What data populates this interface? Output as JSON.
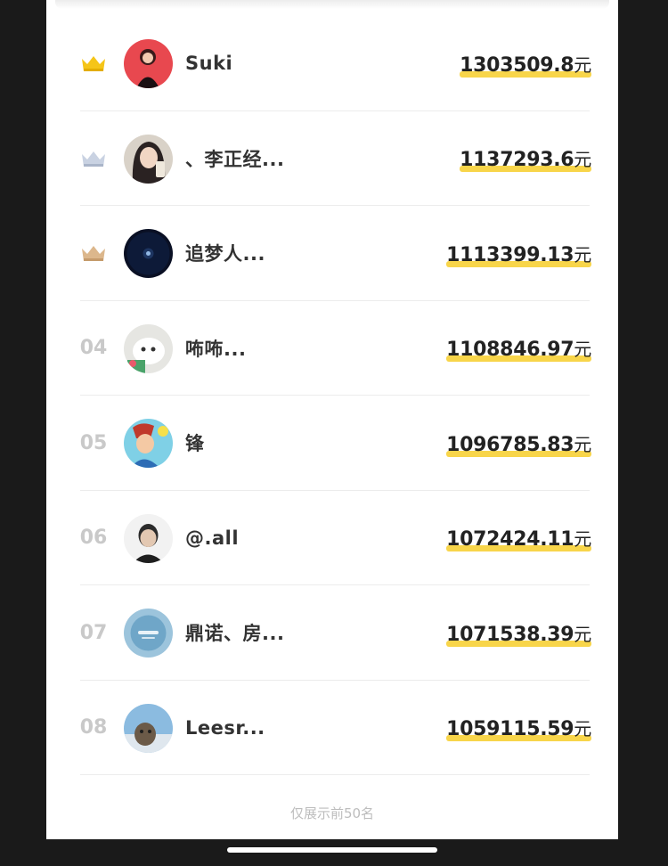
{
  "leaderboard": {
    "rows": [
      {
        "rank": "",
        "medal": "gold",
        "name": "Suki",
        "amount": "1303509.8",
        "unit": "元",
        "avatar": "avatar-red-dress"
      },
      {
        "rank": "",
        "medal": "silver",
        "name": "、李正经...",
        "amount": "1137293.6",
        "unit": "元",
        "avatar": "avatar-woman-selfie"
      },
      {
        "rank": "",
        "medal": "bronze",
        "name": "追梦人...",
        "amount": "1113399.13",
        "unit": "元",
        "avatar": "avatar-night-sky"
      },
      {
        "rank": "04",
        "medal": "",
        "name": "咘咘...",
        "amount": "1108846.97",
        "unit": "元",
        "avatar": "avatar-cat"
      },
      {
        "rank": "05",
        "medal": "",
        "name": "锋",
        "amount": "1096785.83",
        "unit": "元",
        "avatar": "avatar-cartoon-hero"
      },
      {
        "rank": "06",
        "medal": "",
        "name": "@.all",
        "amount": "1072424.11",
        "unit": "元",
        "avatar": "avatar-man-portrait"
      },
      {
        "rank": "07",
        "medal": "",
        "name": "鼎诺、房...",
        "amount": "1071538.39",
        "unit": "元",
        "avatar": "avatar-blue-logo"
      },
      {
        "rank": "08",
        "medal": "",
        "name": "Leesr...",
        "amount": "1059115.59",
        "unit": "元",
        "avatar": "avatar-cat-window"
      }
    ],
    "footer_note": "仅展示前50名"
  },
  "colors": {
    "gold": "#f5c518",
    "silver": "#bfc8d8",
    "bronze": "#d9b48a",
    "highlight": "#f8d54a"
  }
}
